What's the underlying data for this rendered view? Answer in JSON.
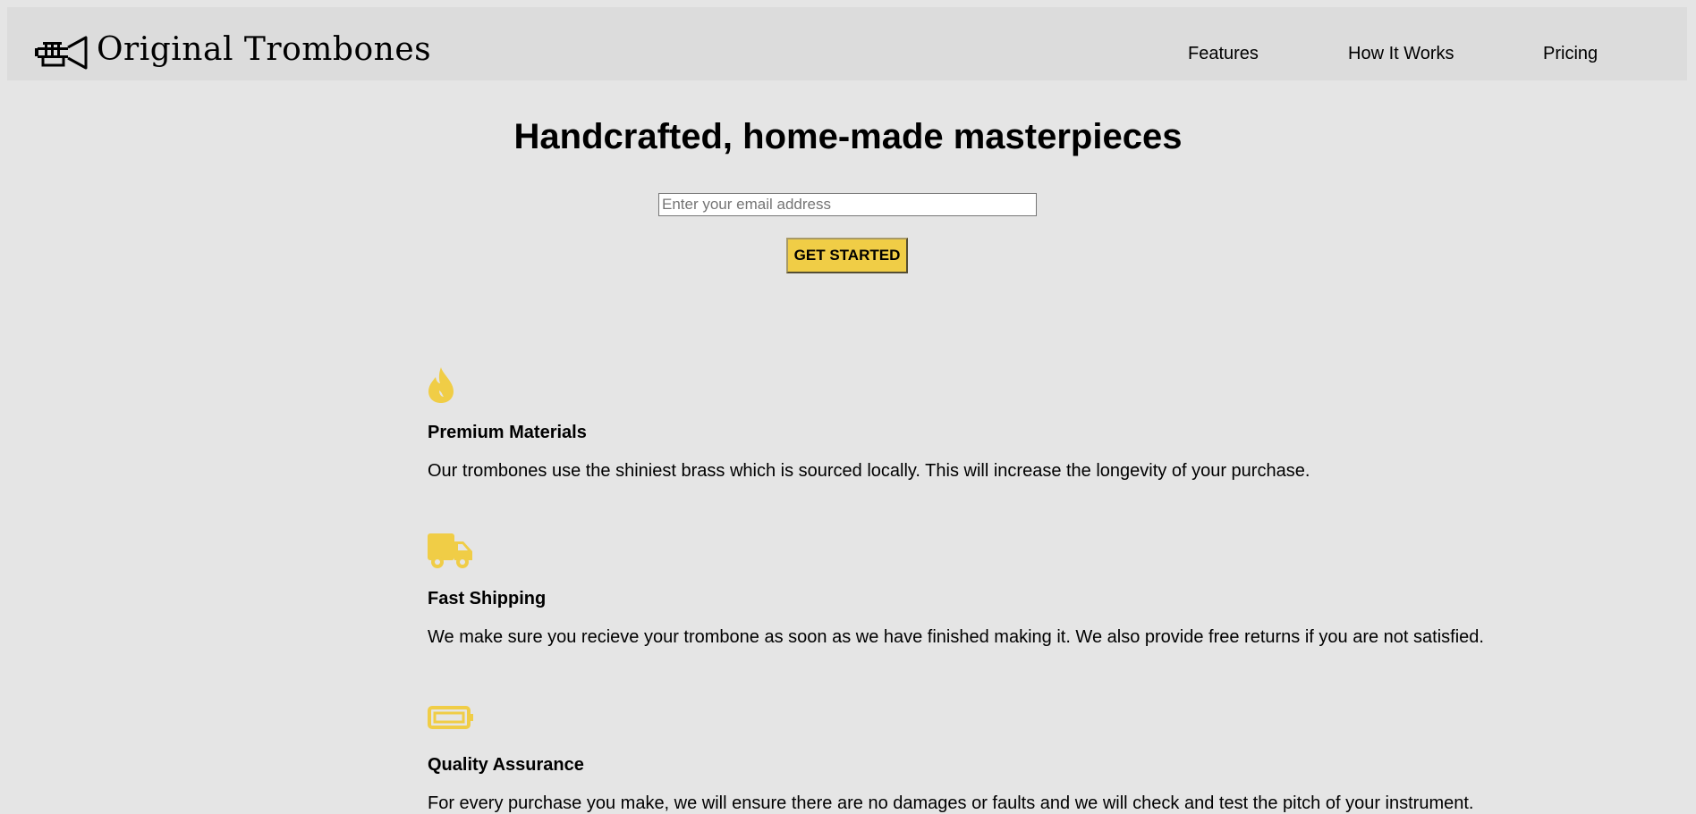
{
  "header": {
    "logo_icon": "trumpet-icon",
    "brand": "Original Trombones",
    "nav": [
      {
        "label": "Features"
      },
      {
        "label": "How It Works"
      },
      {
        "label": "Pricing"
      }
    ]
  },
  "hero": {
    "title": "Handcrafted, home-made masterpieces",
    "email_placeholder": "Enter your email address",
    "email_value": "",
    "cta_label": "GET STARTED"
  },
  "features": [
    {
      "icon": "flame-icon",
      "title": "Premium Materials",
      "text": "Our trombones use the shiniest brass which is sourced locally. This will increase the longevity of your purchase."
    },
    {
      "icon": "truck-icon",
      "title": "Fast Shipping",
      "text": "We make sure you recieve your trombone as soon as we have finished making it. We also provide free returns if you are not satisfied."
    },
    {
      "icon": "battery-icon",
      "title": "Quality Assurance",
      "text": "For every purchase you make, we will ensure there are no damages or faults and we will check and test the pitch of your instrument."
    }
  ],
  "colors": {
    "accent": "#f0cd46",
    "page_background": "#e5e5e5",
    "header_background": "#dcdcdc"
  }
}
